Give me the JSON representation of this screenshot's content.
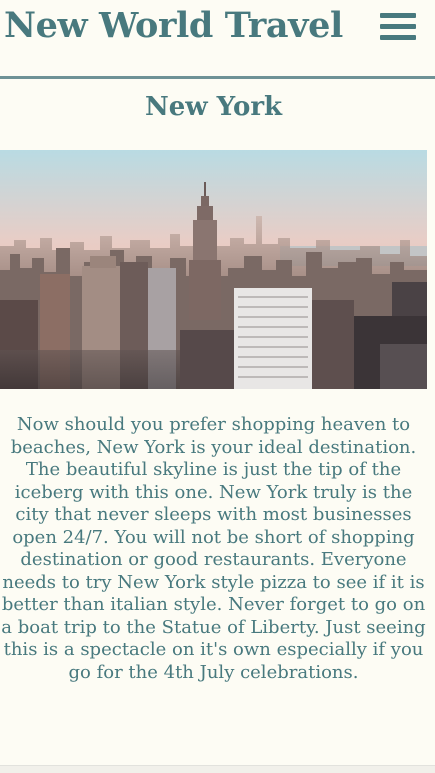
{
  "header": {
    "site_title": "New World Travel",
    "menu_icon": "hamburger-menu-icon"
  },
  "destination": {
    "heading": "New York",
    "image_subject": "new-york-skyline-photo",
    "description": "Now should you prefer shopping heaven to beaches, New York is your ideal destination. The beautiful skyline is just the tip of the iceberg with this one. New York truly is the city that never sleeps with most businesses open 24/7. You will not be short of shopping destination or good restaurants. Everyone needs to try New York style pizza to see if it is better than italian style. Never forget to go on a boat trip to the Statue of Liberty. Just seeing this is a spectacle on it's own especially if you go for the 4th July celebrations."
  },
  "colors": {
    "background": "#fdfcf4",
    "accent": "#48797e",
    "rule": "#6e9296"
  }
}
